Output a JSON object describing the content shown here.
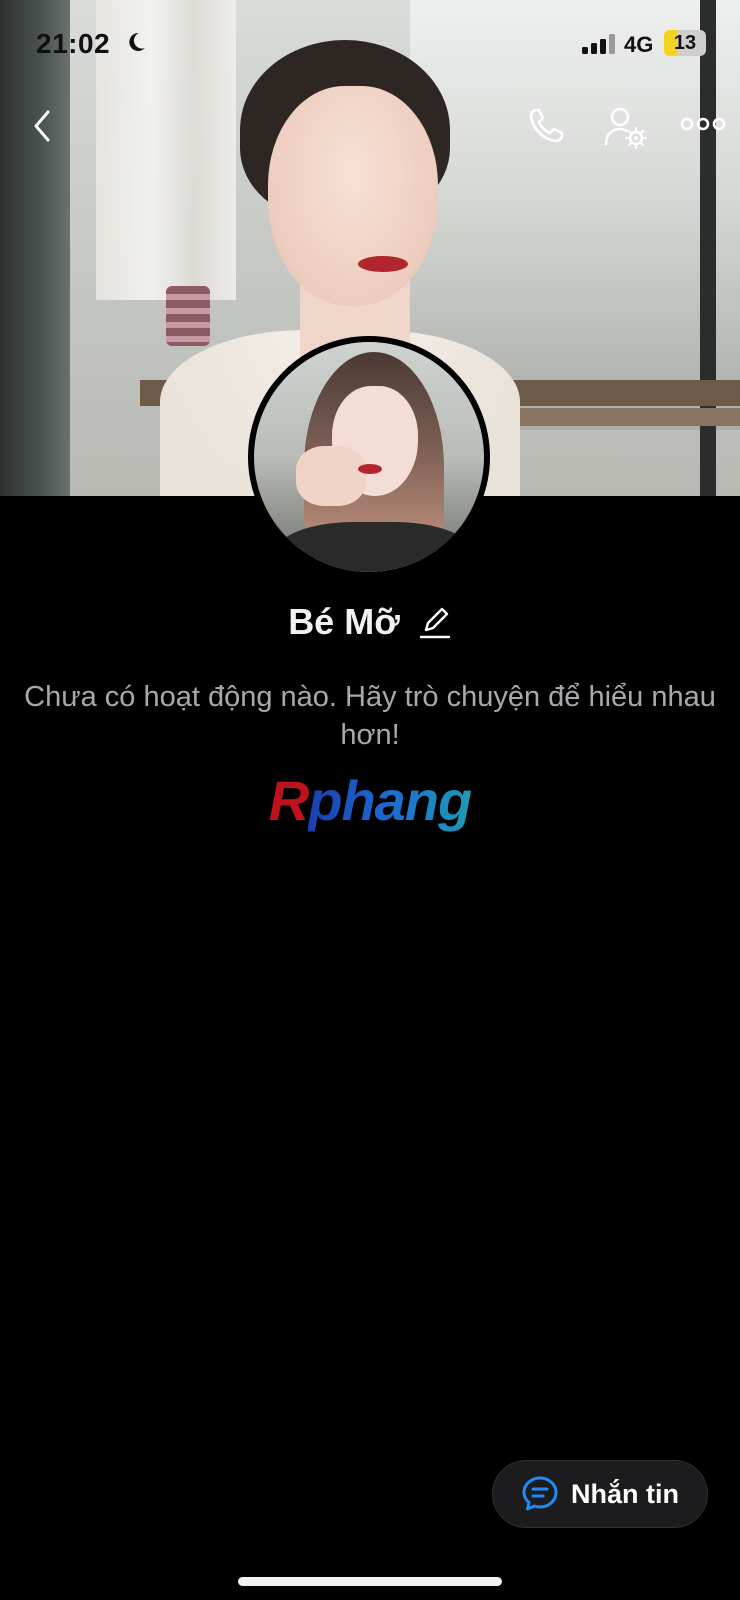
{
  "status_bar": {
    "time": "21:02",
    "network": "4G",
    "battery_level": "13",
    "battery_fraction": 0.13,
    "icons": [
      "moon-icon",
      "signal-icon"
    ]
  },
  "nav": {
    "icons": [
      "back-icon",
      "phone-icon",
      "profile-settings-icon",
      "more-icon"
    ]
  },
  "profile": {
    "name": "Bé Mỡ",
    "empty_message": "Chưa có hoạt động nào. Hãy trò chuyện để hiểu nhau hơn!"
  },
  "watermark": {
    "first_letter": "R",
    "rest": "phang"
  },
  "actions": {
    "message_label": "Nhắn tin"
  },
  "colors": {
    "background": "#000000",
    "accent_blue": "#1d8cf8",
    "battery": "#f5d21d",
    "muted_text": "#a7a9ad"
  }
}
